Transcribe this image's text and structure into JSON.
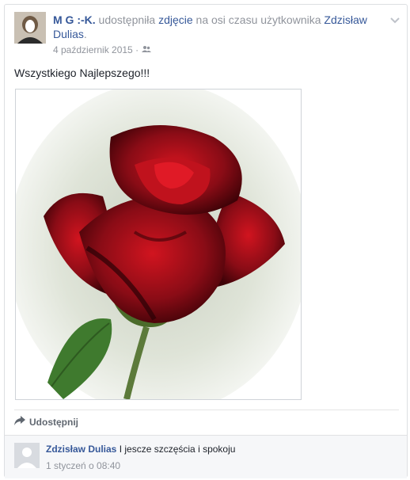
{
  "post": {
    "author": "M G :-K.",
    "action_text": "udostępniła",
    "object_link": "zdjęcie",
    "on_timeline_text": "na osi czasu użytkownika",
    "target_user": "Zdzisław Dulias",
    "period": ".",
    "date": "4 październik 2015 ·",
    "audience_icon": "friends-icon",
    "options_icon": "chevron-down-icon",
    "message": "Wszystkiego Najlepszego!!!",
    "photo_subject": "rose-photo"
  },
  "actions": {
    "share_label": "Udostępnij",
    "share_icon": "share-arrow-icon"
  },
  "comment": {
    "author": "Zdzisław Dulias",
    "text": "I jescze szczęścia i spokoju",
    "time": "1 styczeń o 08:40"
  },
  "colors": {
    "link": "#365899",
    "muted": "#90949c",
    "rose": "#8e0f1a"
  }
}
